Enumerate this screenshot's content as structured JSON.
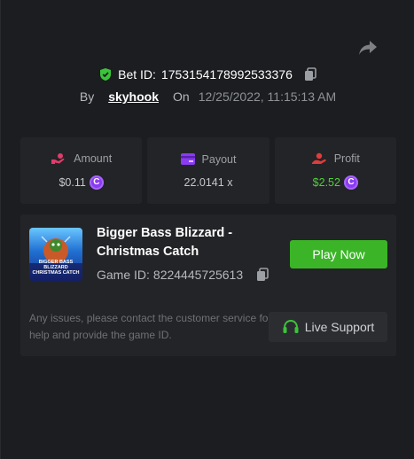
{
  "bet": {
    "label": "Bet ID:",
    "id": "1753154178992533376"
  },
  "meta": {
    "by_label": "By",
    "user": "skyhook",
    "on_label": "On",
    "datetime": "12/25/2022, 11:15:13 AM"
  },
  "stats": {
    "amount": {
      "label": "Amount",
      "value": "$0.11"
    },
    "payout": {
      "label": "Payout",
      "value": "22.0141 x"
    },
    "profit": {
      "label": "Profit",
      "value": "$2.52"
    }
  },
  "game": {
    "title": "Bigger Bass Blizzard - Christmas Catch",
    "thumb_text": "BIGGER BASS BLIZZARD CHRISTMAS CATCH",
    "id_label": "Game ID:",
    "id": "8224445725613",
    "play_label": "Play Now"
  },
  "support": {
    "notice": "Any issues, please contact the customer service for help and provide the game ID.",
    "button_label": "Live Support"
  },
  "colors": {
    "accent_green": "#3bb527",
    "profit_green": "#4fd03a",
    "amount_icon": "#e03c6a",
    "payout_icon": "#8a3cf0",
    "profit_icon": "#e03c3c",
    "coin": "#8a3cf0"
  }
}
